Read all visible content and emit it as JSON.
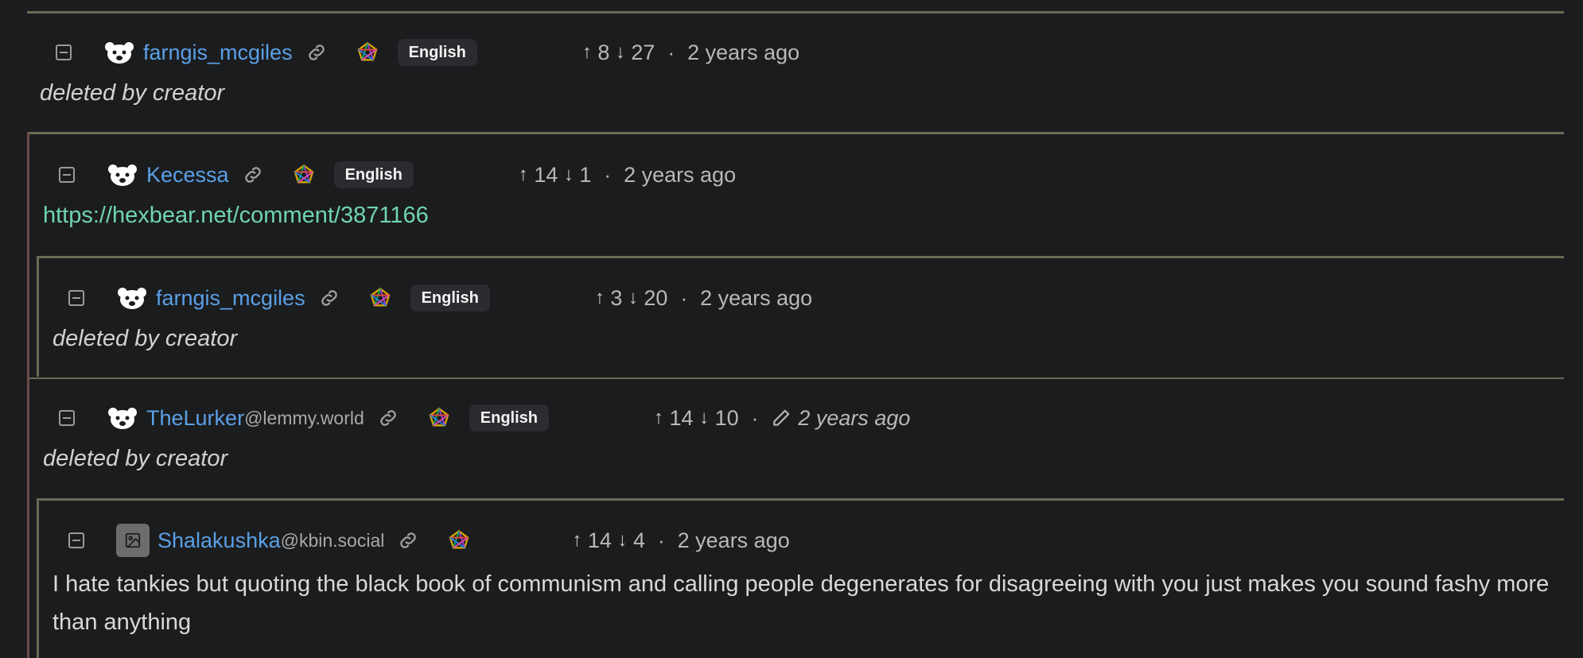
{
  "comments": [
    {
      "username": "farngis_mcgiles",
      "instance": "",
      "language": "English",
      "upvotes": "8",
      "downvotes": "27",
      "time": "2 years ago",
      "body": "deleted by creator"
    },
    {
      "username": "Kecessa",
      "instance": "",
      "language": "English",
      "upvotes": "14",
      "downvotes": "1",
      "time": "2 years ago",
      "body": "https://hexbear.net/comment/3871166"
    },
    {
      "username": "farngis_mcgiles",
      "instance": "",
      "language": "English",
      "upvotes": "3",
      "downvotes": "20",
      "time": "2 years ago",
      "body": "deleted by creator"
    },
    {
      "username": "TheLurker",
      "instance": "@lemmy.world",
      "language": "English",
      "upvotes": "14",
      "downvotes": "10",
      "time": "2 years ago",
      "body": "deleted by creator"
    },
    {
      "username": "Shalakushka",
      "instance": "@kbin.social",
      "language": "",
      "upvotes": "14",
      "downvotes": "4",
      "time": "2 years ago",
      "body": "I hate tankies but quoting the black book of communism and calling people degenerates for disagreeing with you just makes you sound fashy more than anything"
    }
  ],
  "symbols": {
    "up_arrow": "↑",
    "down_arrow": "↓",
    "separator": "·"
  },
  "colors": {
    "username": "#5aa0e6",
    "link": "#70d4b0",
    "thread_line": "#6b6a55",
    "nest_line": "#6a4a4a"
  }
}
